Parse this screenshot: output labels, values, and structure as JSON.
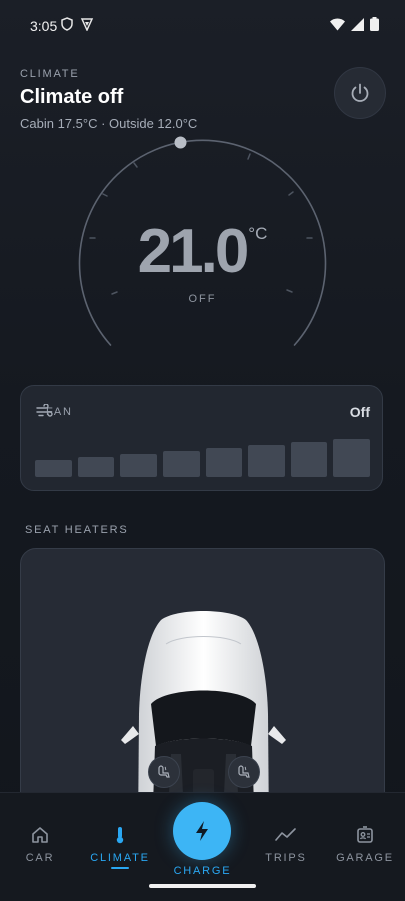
{
  "status_bar": {
    "time": "3:05"
  },
  "header": {
    "eyebrow": "CLIMATE",
    "title": "Climate off",
    "subtitle": "Cabin 17.5°C · Outside 12.0°C"
  },
  "dial": {
    "temperature": "21.0",
    "unit": "°C",
    "state": "OFF"
  },
  "fan": {
    "label": "FAN",
    "value": "Off",
    "levels": 8,
    "active_level": 0
  },
  "seat_heaters": {
    "label": "SEAT HEATERS",
    "seats": [
      "left-seat",
      "right-seat"
    ]
  },
  "nav": {
    "car": "CAR",
    "climate": "CLIMATE",
    "charge": "CHARGE",
    "trips": "TRIPS",
    "garage": "GARAGE",
    "active": "climate"
  },
  "colors": {
    "accent": "#2aa7f2",
    "charge_button": "#3db5f5",
    "background": "#161a21",
    "card": "#222730"
  },
  "icons": {
    "power": "power-icon",
    "fan": "fan-icon",
    "car": "home-icon",
    "climate": "thermometer-icon",
    "charge": "lightning-icon",
    "trips": "trend-line-icon",
    "garage": "id-card-icon"
  }
}
